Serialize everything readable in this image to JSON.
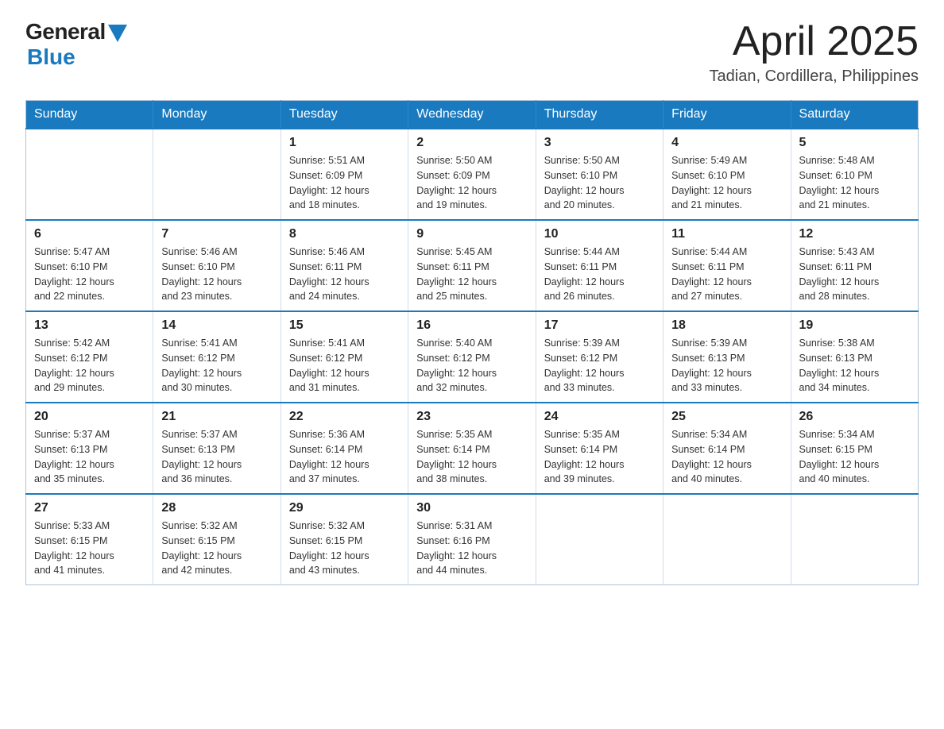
{
  "header": {
    "logo_general": "General",
    "logo_blue": "Blue",
    "title_month": "April 2025",
    "title_location": "Tadian, Cordillera, Philippines"
  },
  "weekdays": [
    "Sunday",
    "Monday",
    "Tuesday",
    "Wednesday",
    "Thursday",
    "Friday",
    "Saturday"
  ],
  "weeks": [
    [
      {
        "day": "",
        "info": ""
      },
      {
        "day": "",
        "info": ""
      },
      {
        "day": "1",
        "info": "Sunrise: 5:51 AM\nSunset: 6:09 PM\nDaylight: 12 hours\nand 18 minutes."
      },
      {
        "day": "2",
        "info": "Sunrise: 5:50 AM\nSunset: 6:09 PM\nDaylight: 12 hours\nand 19 minutes."
      },
      {
        "day": "3",
        "info": "Sunrise: 5:50 AM\nSunset: 6:10 PM\nDaylight: 12 hours\nand 20 minutes."
      },
      {
        "day": "4",
        "info": "Sunrise: 5:49 AM\nSunset: 6:10 PM\nDaylight: 12 hours\nand 21 minutes."
      },
      {
        "day": "5",
        "info": "Sunrise: 5:48 AM\nSunset: 6:10 PM\nDaylight: 12 hours\nand 21 minutes."
      }
    ],
    [
      {
        "day": "6",
        "info": "Sunrise: 5:47 AM\nSunset: 6:10 PM\nDaylight: 12 hours\nand 22 minutes."
      },
      {
        "day": "7",
        "info": "Sunrise: 5:46 AM\nSunset: 6:10 PM\nDaylight: 12 hours\nand 23 minutes."
      },
      {
        "day": "8",
        "info": "Sunrise: 5:46 AM\nSunset: 6:11 PM\nDaylight: 12 hours\nand 24 minutes."
      },
      {
        "day": "9",
        "info": "Sunrise: 5:45 AM\nSunset: 6:11 PM\nDaylight: 12 hours\nand 25 minutes."
      },
      {
        "day": "10",
        "info": "Sunrise: 5:44 AM\nSunset: 6:11 PM\nDaylight: 12 hours\nand 26 minutes."
      },
      {
        "day": "11",
        "info": "Sunrise: 5:44 AM\nSunset: 6:11 PM\nDaylight: 12 hours\nand 27 minutes."
      },
      {
        "day": "12",
        "info": "Sunrise: 5:43 AM\nSunset: 6:11 PM\nDaylight: 12 hours\nand 28 minutes."
      }
    ],
    [
      {
        "day": "13",
        "info": "Sunrise: 5:42 AM\nSunset: 6:12 PM\nDaylight: 12 hours\nand 29 minutes."
      },
      {
        "day": "14",
        "info": "Sunrise: 5:41 AM\nSunset: 6:12 PM\nDaylight: 12 hours\nand 30 minutes."
      },
      {
        "day": "15",
        "info": "Sunrise: 5:41 AM\nSunset: 6:12 PM\nDaylight: 12 hours\nand 31 minutes."
      },
      {
        "day": "16",
        "info": "Sunrise: 5:40 AM\nSunset: 6:12 PM\nDaylight: 12 hours\nand 32 minutes."
      },
      {
        "day": "17",
        "info": "Sunrise: 5:39 AM\nSunset: 6:12 PM\nDaylight: 12 hours\nand 33 minutes."
      },
      {
        "day": "18",
        "info": "Sunrise: 5:39 AM\nSunset: 6:13 PM\nDaylight: 12 hours\nand 33 minutes."
      },
      {
        "day": "19",
        "info": "Sunrise: 5:38 AM\nSunset: 6:13 PM\nDaylight: 12 hours\nand 34 minutes."
      }
    ],
    [
      {
        "day": "20",
        "info": "Sunrise: 5:37 AM\nSunset: 6:13 PM\nDaylight: 12 hours\nand 35 minutes."
      },
      {
        "day": "21",
        "info": "Sunrise: 5:37 AM\nSunset: 6:13 PM\nDaylight: 12 hours\nand 36 minutes."
      },
      {
        "day": "22",
        "info": "Sunrise: 5:36 AM\nSunset: 6:14 PM\nDaylight: 12 hours\nand 37 minutes."
      },
      {
        "day": "23",
        "info": "Sunrise: 5:35 AM\nSunset: 6:14 PM\nDaylight: 12 hours\nand 38 minutes."
      },
      {
        "day": "24",
        "info": "Sunrise: 5:35 AM\nSunset: 6:14 PM\nDaylight: 12 hours\nand 39 minutes."
      },
      {
        "day": "25",
        "info": "Sunrise: 5:34 AM\nSunset: 6:14 PM\nDaylight: 12 hours\nand 40 minutes."
      },
      {
        "day": "26",
        "info": "Sunrise: 5:34 AM\nSunset: 6:15 PM\nDaylight: 12 hours\nand 40 minutes."
      }
    ],
    [
      {
        "day": "27",
        "info": "Sunrise: 5:33 AM\nSunset: 6:15 PM\nDaylight: 12 hours\nand 41 minutes."
      },
      {
        "day": "28",
        "info": "Sunrise: 5:32 AM\nSunset: 6:15 PM\nDaylight: 12 hours\nand 42 minutes."
      },
      {
        "day": "29",
        "info": "Sunrise: 5:32 AM\nSunset: 6:15 PM\nDaylight: 12 hours\nand 43 minutes."
      },
      {
        "day": "30",
        "info": "Sunrise: 5:31 AM\nSunset: 6:16 PM\nDaylight: 12 hours\nand 44 minutes."
      },
      {
        "day": "",
        "info": ""
      },
      {
        "day": "",
        "info": ""
      },
      {
        "day": "",
        "info": ""
      }
    ]
  ]
}
